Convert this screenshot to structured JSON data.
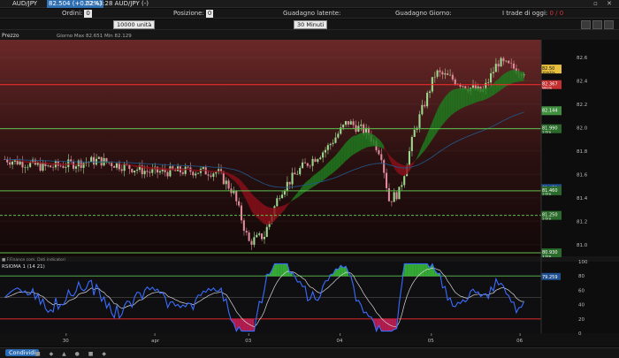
{
  "titlebar": {
    "symbol": "AUD/JPY",
    "price": "82.504 (+0.02%)",
    "time": "22:43:28 AUD/JPY (-)"
  },
  "orderbar": {
    "ordini_label": "Ordini:",
    "ordini_val": "0",
    "posizione_label": "Posizione:",
    "posizione_val": "0",
    "latente_label": "Guadagno latente:",
    "giorno_label": "Guadagno Giorno:",
    "trades_label": "I trade di oggi:",
    "trades_val": "0 / 0"
  },
  "toolbar": {
    "units": "10000 unità",
    "interval": "30 Minuti"
  },
  "statusbar": {
    "button": "Condividi"
  },
  "chart_data": {
    "type": "candlestick",
    "panel_title": "Prezzo",
    "legend_text": "Giorno Max 82.651 Min 82.129",
    "yticks": [
      82.6,
      82.4,
      82.2,
      82.0,
      81.8,
      81.6,
      81.4,
      81.2,
      81.0
    ],
    "ylim": [
      80.9,
      82.75
    ],
    "xticks": [
      "30",
      "apr",
      "03",
      "04",
      "05",
      "06"
    ],
    "price_labels": [
      {
        "value": "82.50",
        "color": "#e8c040",
        "text_color": "#101010"
      },
      {
        "value": "82.367",
        "color": "#c23030",
        "text_color": "#ffffff"
      },
      {
        "value": "82.144",
        "color": "#3f8f3f",
        "text_color": "#ffffff"
      },
      {
        "value": "81.990",
        "color": "#2a6a2a",
        "text_color": "#ffffff"
      },
      {
        "value": "81.479",
        "color": "#1f4f8f",
        "text_color": "#ffffff"
      },
      {
        "value": "81.460",
        "color": "#2a6a2a",
        "text_color": "#ffffff"
      },
      {
        "value": "81.250",
        "color": "#2a6a2a",
        "text_color": "#ffffff"
      },
      {
        "value": "80.930",
        "color": "#2a6a2a",
        "text_color": "#ffffff"
      }
    ],
    "price_label_subtexts": [
      "10m32s",
      "Valore",
      "",
      "1 Ora",
      "",
      "1 Ora",
      "1 Ora",
      "1 Ora"
    ],
    "hlines": [
      {
        "y": 82.367,
        "color": "#ff2a2a"
      },
      {
        "y": 81.99,
        "color": "#5fbf4f"
      },
      {
        "y": 81.46,
        "color": "#5fbf4f"
      },
      {
        "y": 81.25,
        "color": "#5fbf4f",
        "dashed": true
      },
      {
        "y": 80.93,
        "color": "#5fbf4f"
      }
    ],
    "indicator": {
      "title": "RSIOMA 1 (14 21)",
      "header_text": "■ F.Finance com. Dati indicatori",
      "yticks": [
        100,
        80,
        60,
        40,
        20,
        0
      ],
      "ylim": [
        0,
        100
      ],
      "value_label": "79.259",
      "levels": [
        {
          "y": 80,
          "color": "#5fbf4f"
        },
        {
          "y": 20,
          "color": "#ff2a2a"
        },
        {
          "y": 50,
          "color": "#444444"
        }
      ]
    },
    "series_colors": {
      "up": "#9fd88f",
      "down": "#e08a9a",
      "fast_ma": "#1f8f2f",
      "slow_ma": "#1f5a8f",
      "rsi": "#3a6cff",
      "rsi_signal": "#d8d8d8"
    }
  }
}
